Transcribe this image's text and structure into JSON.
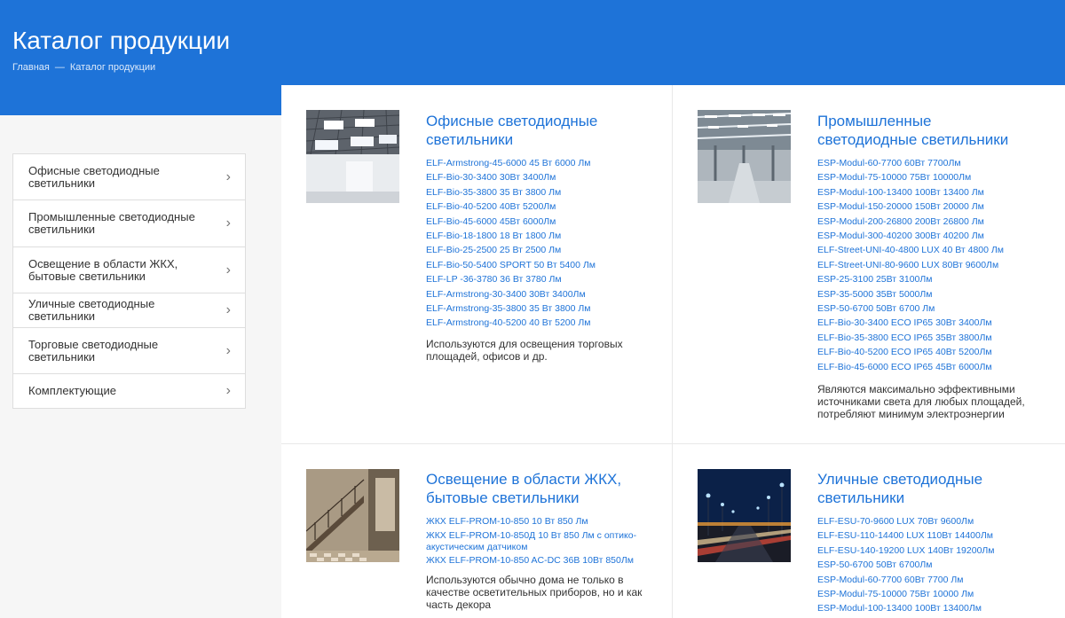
{
  "header": {
    "title": "Каталог продукции",
    "breadcrumb": {
      "home": "Главная",
      "separator": "—",
      "current": "Каталог продукции"
    }
  },
  "sidebar": {
    "items": [
      {
        "label": "Офисные светодиодные светильники",
        "icon": "chevron-right-icon"
      },
      {
        "label": "Промышленные светодиодные светильники",
        "icon": "chevron-right-icon"
      },
      {
        "label": "Освещение в области ЖКХ, бытовые светильники",
        "icon": "chevron-right-icon"
      },
      {
        "label": "Уличные светодиодные светильники",
        "icon": "chevron-right-icon"
      },
      {
        "label": "Торговые светодиодные светильники",
        "icon": "chevron-right-icon"
      },
      {
        "label": "Комплектующие",
        "icon": "chevron-right-icon"
      }
    ]
  },
  "cards": [
    {
      "title": "Офисные светодиодные светильники",
      "links": [
        "ELF-Armstrong-45-6000 45 Вт 6000 Лм",
        "ELF-Bio-30-3400 30Вт 3400Лм",
        "ELF-Bio-35-3800 35 Вт 3800 Лм",
        "ELF-Bio-40-5200 40Вт 5200Лм",
        "ELF-Bio-45-6000 45Вт 6000Лм",
        "ELF-Bio-18-1800 18 Вт 1800 Лм",
        "ELF-Bio-25-2500 25 Вт 2500 Лм",
        "ELF-Bio-50-5400 SPORT 50 Вт 5400 Лм",
        "ELF-LP -36-3780 36 Вт 3780 Лм",
        "ELF-Armstrong-30-3400 30Вт 3400Лм",
        "ELF-Armstrong-35-3800 35 Вт 3800 Лм",
        "ELF-Armstrong-40-5200 40 Вт 5200 Лм"
      ],
      "description": "Используются для освещения торговых площадей, офисов и др."
    },
    {
      "title": "Промышленные светодиодные светильники",
      "links": [
        "ESP-Modul-60-7700 60Вт 7700Лм",
        "ESP-Modul-75-10000 75Вт 10000Лм",
        "ESP-Modul-100-13400 100Вт 13400 Лм",
        "ESP-Modul-150-20000 150Вт 20000 Лм",
        "ESP-Modul-200-26800 200Вт 26800 Лм",
        "ESP-Modul-300-40200 300Вт 40200 Лм",
        "ELF-Street-UNI-40-4800 LUX 40 Вт 4800 Лм",
        "ELF-Street-UNI-80-9600 LUX 80Вт 9600Лм",
        "ESP-25-3100 25Вт 3100Лм",
        "ESP-35-5000 35Вт 5000Лм",
        "ESP-50-6700 50Вт 6700 Лм",
        "ELF-Bio-30-3400 ECO IP65 30Вт 3400Лм",
        "ELF-Bio-35-3800 ECO IP65 35Вт 3800Лм",
        "ELF-Bio-40-5200 ECO IP65 40Вт 5200Лм",
        "ELF-Bio-45-6000 ECO IP65 45Вт 6000Лм"
      ],
      "description": "Являются максимально эффективными источниками света для любых площадей, потребляют минимум электроэнергии"
    },
    {
      "title": "Освещение в области ЖКХ, бытовые светильники",
      "links": [
        "ЖКХ ELF-PROM-10-850 10 Вт 850 Лм",
        "ЖКХ ELF-PROM-10-850Д 10 Вт 850 Лм с оптико-акустическим датчиком",
        "ЖКХ ELF-PROM-10-850 AC-DC 36В 10Вт 850Лм"
      ],
      "description": "Используются обычно дома не только в качестве осветительных приборов, но и как часть декора"
    },
    {
      "title": "Уличные светодиодные светильники",
      "links": [
        "ELF-ESU-70-9600 LUX 70Вт 9600Лм",
        "ELF-ESU-110-14400 LUX 110Вт 14400Лм",
        "ELF-ESU-140-19200 LUX 140Вт 19200Лм",
        "ESP-50-6700 50Вт 6700Лм",
        "ESP-Modul-60-7700 60Вт 7700 Лм",
        "ESP-Modul-75-10000 75Вт 10000 Лм",
        "ESP-Modul-100-13400 100Вт 13400Лм"
      ],
      "description": ""
    }
  ],
  "colors": {
    "header_bg": "#1e73d8",
    "link": "#1e73d8",
    "page_bg": "#f6f6f6"
  }
}
